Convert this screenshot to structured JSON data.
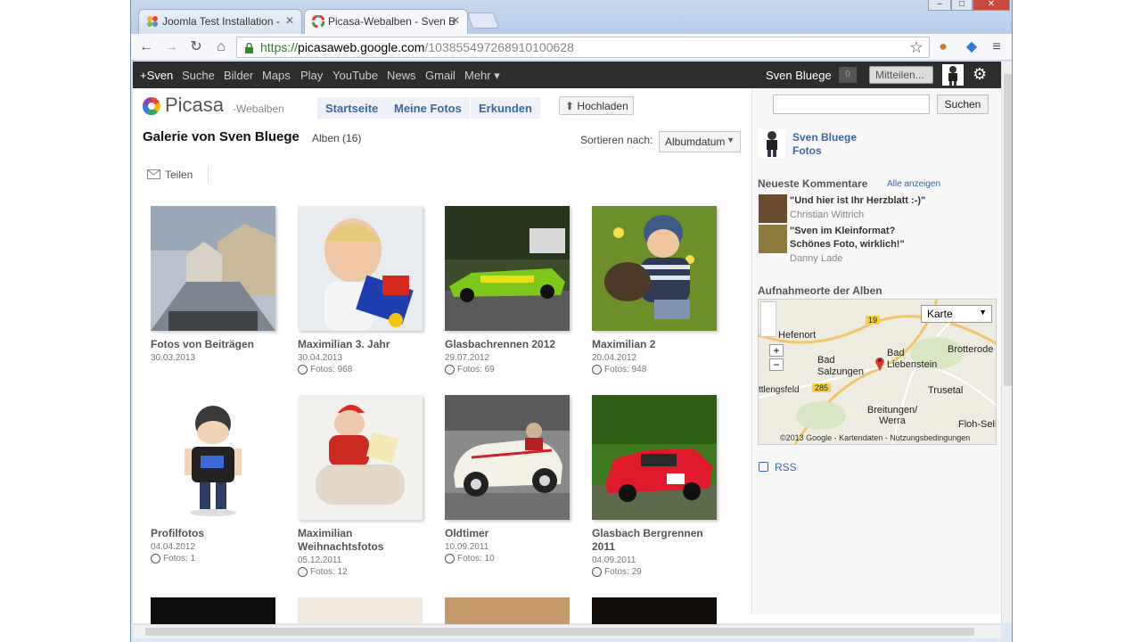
{
  "browser": {
    "tabs": [
      {
        "title": "Joomla Test Installation -",
        "active": false
      },
      {
        "title": "Picasa-Webalben - Sven B",
        "active": true
      }
    ],
    "url_scheme": "https://",
    "url_host": "picasaweb.google.com",
    "url_path": "/103855497268910100628"
  },
  "gbar": {
    "items": [
      "+Sven",
      "Suche",
      "Bilder",
      "Maps",
      "Play",
      "YouTube",
      "News",
      "Gmail",
      "Mehr ▾"
    ],
    "user": "Sven Bluege",
    "count": "0",
    "share_label": "Mitteilen..."
  },
  "header": {
    "logo": "Picasa",
    "logo_sub": "-Webalben",
    "tabs": [
      "Startseite",
      "Meine Fotos",
      "Erkunden"
    ],
    "upload_label": "Hochladen",
    "search_button": "Suchen"
  },
  "gallery": {
    "title": "Galerie von Sven Bluege",
    "count": "Alben (16)",
    "sort_label": "Sortieren nach:",
    "sort_value": "Albumdatum",
    "share_label": "Teilen",
    "albums": [
      {
        "name": "Fotos von Beiträgen",
        "date": "30.03.2013",
        "count": ""
      },
      {
        "name": "Maximilian 3. Jahr",
        "date": "30.04.2013",
        "count": "Fotos: 968"
      },
      {
        "name": "Glasbachrennen 2012",
        "date": "29.07.2012",
        "count": "Fotos: 69"
      },
      {
        "name": "Maximilian 2",
        "date": "20.04.2012",
        "count": "Fotos: 948"
      },
      {
        "name": "Profilfotos",
        "date": "04.04.2012",
        "count": "Fotos: 1"
      },
      {
        "name": "Maximilian Weihnachtsfotos",
        "date": "05.12.2011",
        "count": "Fotos: 12"
      },
      {
        "name": "Oldtimer",
        "date": "10.09.2011",
        "count": "Fotos: 10"
      },
      {
        "name": "Glasbach Bergrennen 2011",
        "date": "04.09.2011",
        "count": "Fotos: 29"
      }
    ]
  },
  "sidebar": {
    "user_name": "Sven Bluege",
    "user_sub": "Fotos",
    "comments_head": "Neueste Kommentare",
    "comments_all": "Alle anzeigen",
    "comments": [
      {
        "text": "\"Und hier ist Ihr Herzblatt :-)\"",
        "author": "Christian Wittrich"
      },
      {
        "text": "\"Sven im Kleinformat? Schönes Foto, wirklich!\"",
        "author": "Danny Lade"
      }
    ],
    "map_head": "Aufnahmeorte der Alben",
    "map_select": "Karte",
    "map_labels": [
      "Hefenort",
      "Bad Salzungen",
      "Bad Liebenstein",
      "Brotterode",
      "Trusetal",
      "Breitungen/ Werra",
      "Floh-Seli",
      "ttlengsfeld",
      "19",
      "285"
    ],
    "map_footer": "©2013 Google - Kartendaten - Nutzungsbedingungen",
    "rss": "RSS"
  },
  "colors": {
    "gbar_bg": "#2d2d2d",
    "link": "#3c67a5",
    "tab_bg": "#eef2f8"
  }
}
